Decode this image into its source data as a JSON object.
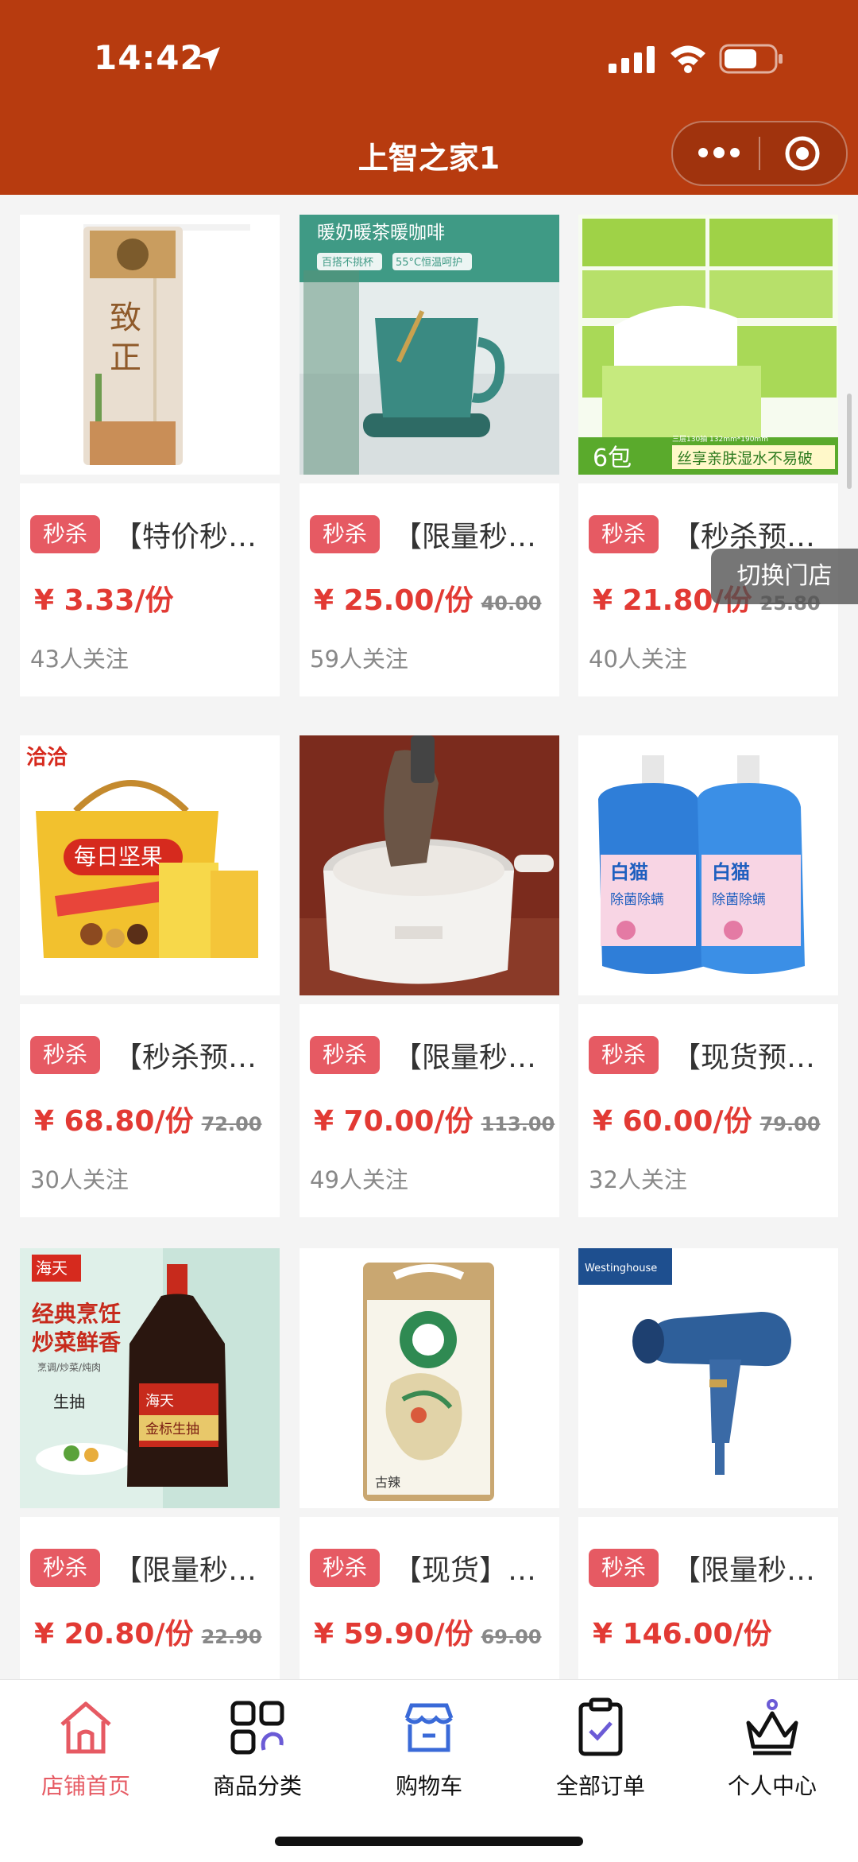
{
  "status": {
    "time": "14:42"
  },
  "nav": {
    "title": "上智之家1"
  },
  "floating": {
    "switch_store": "切换门店"
  },
  "products": [
    {
      "badge": "秒杀",
      "name": "【特价秒杀】致正挂面",
      "price": "¥ 3.33/份",
      "old_price": "",
      "followers": "43人关注"
    },
    {
      "badge": "秒杀",
      "name": "【限量秒杀】暖奶暖茶暖咖啡",
      "price": "¥ 25.00/份",
      "old_price": "40.00",
      "followers": "59人关注"
    },
    {
      "badge": "秒杀",
      "name": "【秒杀预售】心相印抽纸",
      "price": "¥ 21.80/份",
      "old_price": "25.80",
      "followers": "40人关注"
    },
    {
      "badge": "秒杀",
      "name": "【秒杀预售】洽洽每日坚果",
      "price": "¥ 68.80/份",
      "old_price": "72.00",
      "followers": "30人关注"
    },
    {
      "badge": "秒杀",
      "name": "【限量秒杀】电煮锅",
      "price": "¥ 70.00/份",
      "old_price": "113.00",
      "followers": "49人关注"
    },
    {
      "badge": "秒杀",
      "name": "【现货预售】白猫洗衣液",
      "price": "¥ 60.00/份",
      "old_price": "79.00",
      "followers": "32人关注"
    },
    {
      "badge": "秒杀",
      "name": "【限量秒杀】海天生抽",
      "price": "¥ 20.80/份",
      "old_price": "22.90",
      "followers": ""
    },
    {
      "badge": "秒杀",
      "name": "【现货】古辣大米",
      "price": "¥ 59.90/份",
      "old_price": "69.00",
      "followers": ""
    },
    {
      "badge": "秒杀",
      "name": "【限量秒杀】西屋吹风机",
      "price": "¥ 146.00/份",
      "old_price": "",
      "followers": ""
    }
  ],
  "image_text": {
    "p2_headline": "暖奶暖茶暖咖啡",
    "p2_tag1": "百搭不挑杯",
    "p2_tag2": "55°C恒温呵护",
    "p3_count": "6包",
    "p3_slogan": "丝享亲肤湿水不易破",
    "p3_spec": "三层130抽 132mm*190mm",
    "p4_brand": "洽洽",
    "p4_product": "每日坚果",
    "p6_brand": "白猫",
    "p6_product": "除菌除螨",
    "p7_brand": "海天",
    "p7_line1": "经典烹饪",
    "p7_line2": "炒菜鲜香",
    "p7_sub": "烹调/炒菜/炖肉",
    "p7_item": "生抽",
    "p7_bottle": "金标生抽",
    "p8_name": "古辣",
    "p9_brand": "Westinghouse"
  },
  "tabs": [
    {
      "label": "店铺首页",
      "icon": "home-icon"
    },
    {
      "label": "商品分类",
      "icon": "category-icon"
    },
    {
      "label": "购物车",
      "icon": "cart-icon"
    },
    {
      "label": "全部订单",
      "icon": "order-icon"
    },
    {
      "label": "个人中心",
      "icon": "crown-icon"
    }
  ],
  "colors": {
    "brand": "#b73b0f",
    "badge": "#e65a63",
    "price": "#e23a34"
  }
}
